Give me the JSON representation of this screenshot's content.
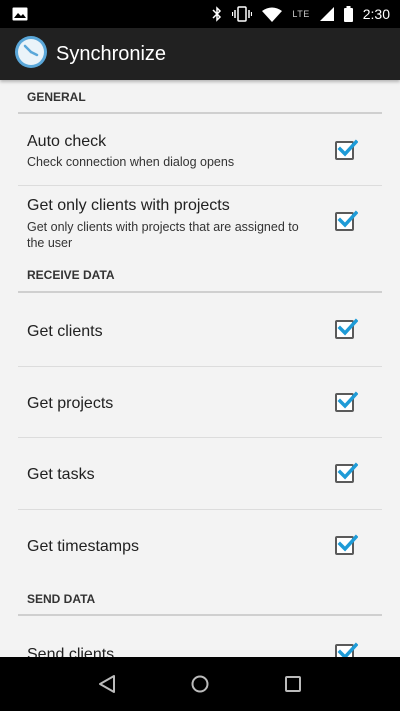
{
  "status_bar": {
    "network_label": "LTE",
    "time": "2:30",
    "icons": [
      "image-icon",
      "bluetooth-icon",
      "vibrate-icon",
      "wifi-icon",
      "cell-signal-icon",
      "battery-icon"
    ]
  },
  "app_bar": {
    "title": "Synchronize",
    "icon": "clock-icon"
  },
  "sections": {
    "general": {
      "header": "GENERAL",
      "items": [
        {
          "title": "Auto check",
          "summary": "Check connection when dialog opens",
          "checked": true
        },
        {
          "title": "Get only clients with projects",
          "summary": "Get only clients with projects that are assigned to the user",
          "checked": true
        }
      ]
    },
    "receive": {
      "header": "RECEIVE DATA",
      "items": [
        {
          "title": "Get clients",
          "checked": true
        },
        {
          "title": "Get projects",
          "checked": true
        },
        {
          "title": "Get tasks",
          "checked": true
        },
        {
          "title": "Get timestamps",
          "checked": true
        }
      ]
    },
    "send": {
      "header": "SEND DATA",
      "items": [
        {
          "title": "Send clients",
          "checked": true
        }
      ]
    }
  },
  "nav_bar": {
    "buttons": [
      "back-icon",
      "home-icon",
      "recents-icon"
    ]
  },
  "colors": {
    "checkmark": "#1e9bd7",
    "app_bar": "#212121",
    "background": "#f3f3f3"
  }
}
